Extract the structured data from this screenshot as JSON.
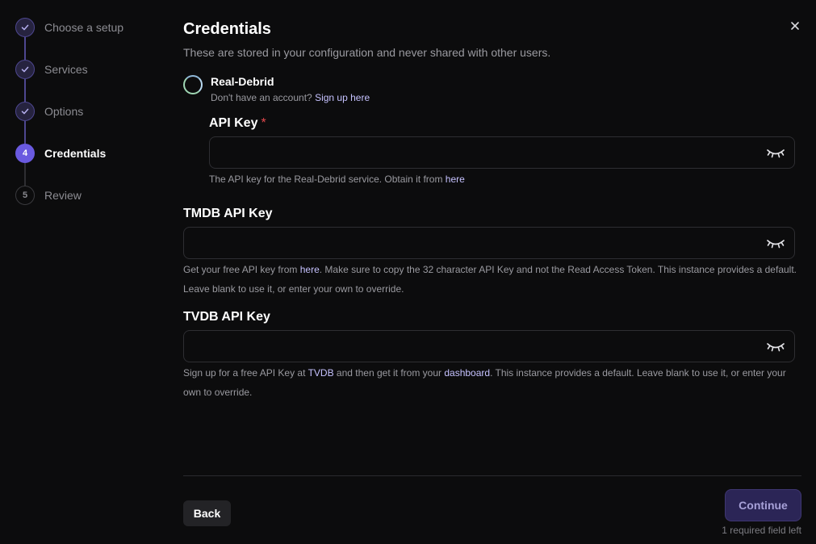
{
  "stepper": {
    "steps": [
      {
        "number": "1",
        "label": "Choose a setup",
        "state": "done"
      },
      {
        "number": "2",
        "label": "Services",
        "state": "done"
      },
      {
        "number": "3",
        "label": "Options",
        "state": "done"
      },
      {
        "number": "4",
        "label": "Credentials",
        "state": "active"
      },
      {
        "number": "5",
        "label": "Review",
        "state": "pending"
      }
    ]
  },
  "header": {
    "title": "Credentials",
    "subtitle": "These are stored in your configuration and never shared with other users."
  },
  "close_icon": "close-icon",
  "service": {
    "name": "Real-Debrid",
    "signup_prefix": "Don't have an account?",
    "signup_link": "Sign up here"
  },
  "fields": {
    "api_key": {
      "label": "API Key",
      "required_mark": "*",
      "value": "",
      "help_prefix": "The API key for the Real-Debrid service. Obtain it from",
      "help_link": "here"
    },
    "tmdb": {
      "label": "TMDB API Key",
      "value": "",
      "help_prefix": "Get your free API key from",
      "help_link": "here",
      "help_suffix": ". Make sure to copy the 32 character API Key and not the Read Access Token. This instance provides a default. Leave blank to use it, or enter your own to override."
    },
    "tvdb": {
      "label": "TVDB API Key",
      "value": "",
      "help_prefix": "Sign up for a free API Key at",
      "help_link1": "TVDB",
      "help_middle": "and then get it from your",
      "help_link2": "dashboard",
      "help_suffix": ". This instance provides a default. Leave blank to use it, or enter your own to override."
    }
  },
  "footer": {
    "back_label": "Back",
    "continue_label": "Continue",
    "required_note": "1 required field left"
  },
  "colors": {
    "accent": "#6a5ae0",
    "link": "#c6c2ff",
    "required": "#e5484d",
    "background": "#0c0c0d"
  }
}
